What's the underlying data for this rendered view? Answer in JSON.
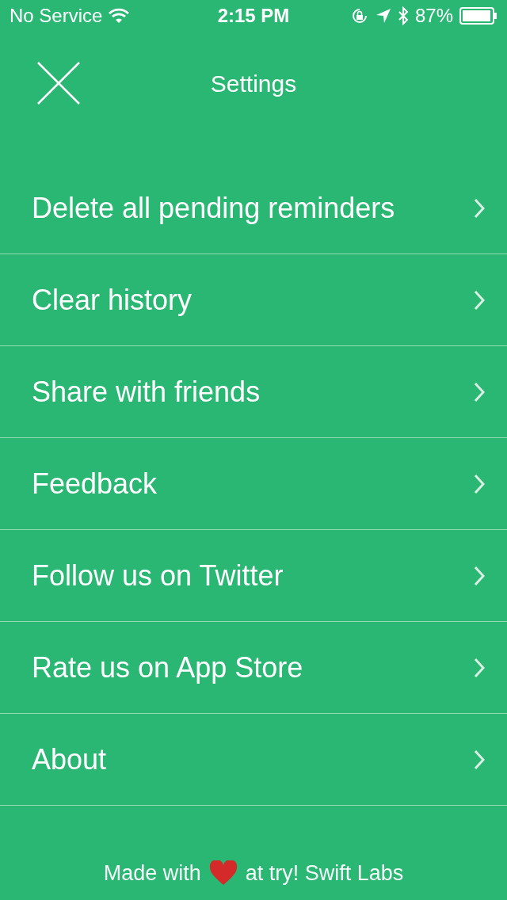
{
  "status_bar": {
    "carrier": "No Service",
    "time": "2:15 PM",
    "battery": "87%"
  },
  "header": {
    "title": "Settings"
  },
  "items": [
    {
      "label": "Delete all pending reminders"
    },
    {
      "label": "Clear history"
    },
    {
      "label": "Share with friends"
    },
    {
      "label": "Feedback"
    },
    {
      "label": "Follow us on Twitter"
    },
    {
      "label": "Rate us on App Store"
    },
    {
      "label": "About"
    }
  ],
  "footer": {
    "before": "Made with",
    "after": "at try! Swift Labs"
  }
}
